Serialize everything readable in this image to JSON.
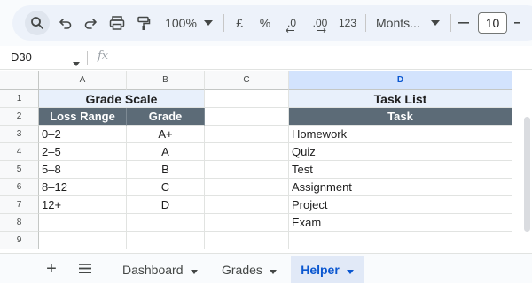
{
  "toolbar": {
    "zoom": "100%",
    "currency": "£",
    "percent": "%",
    "decrease_decimal": ".0",
    "increase_decimal": ".00",
    "number_format": "123",
    "font": "Monts...",
    "font_size": "10",
    "minus": "—"
  },
  "formula_bar": {
    "cell_ref": "D30",
    "fx": "fx",
    "content": ""
  },
  "grid": {
    "columns": [
      "A",
      "B",
      "C",
      "D"
    ],
    "rows": [
      "1",
      "2",
      "3",
      "4",
      "5",
      "6",
      "7",
      "8",
      "9"
    ],
    "grade_scale": {
      "title": "Grade Scale",
      "headers": [
        "Loss Range",
        "Grade"
      ],
      "rows": [
        [
          "0–2",
          "A+"
        ],
        [
          "2–5",
          "A"
        ],
        [
          "5–8",
          "B"
        ],
        [
          "8–12",
          "C"
        ],
        [
          "12+",
          "D"
        ]
      ]
    },
    "task_list": {
      "title": "Task List",
      "header": "Task",
      "items": [
        "Homework",
        "Quiz",
        "Test",
        "Assignment",
        "Project",
        "Exam"
      ]
    }
  },
  "sheets": {
    "add": "+",
    "tabs": [
      "Dashboard",
      "Grades",
      "Helper"
    ],
    "active": "Helper"
  },
  "colors": {
    "header_fill": "#5c6b77",
    "title_fill": "#e8f0fb",
    "active_tab": "#0b57d0",
    "selected_column": "#d3e3fd"
  }
}
